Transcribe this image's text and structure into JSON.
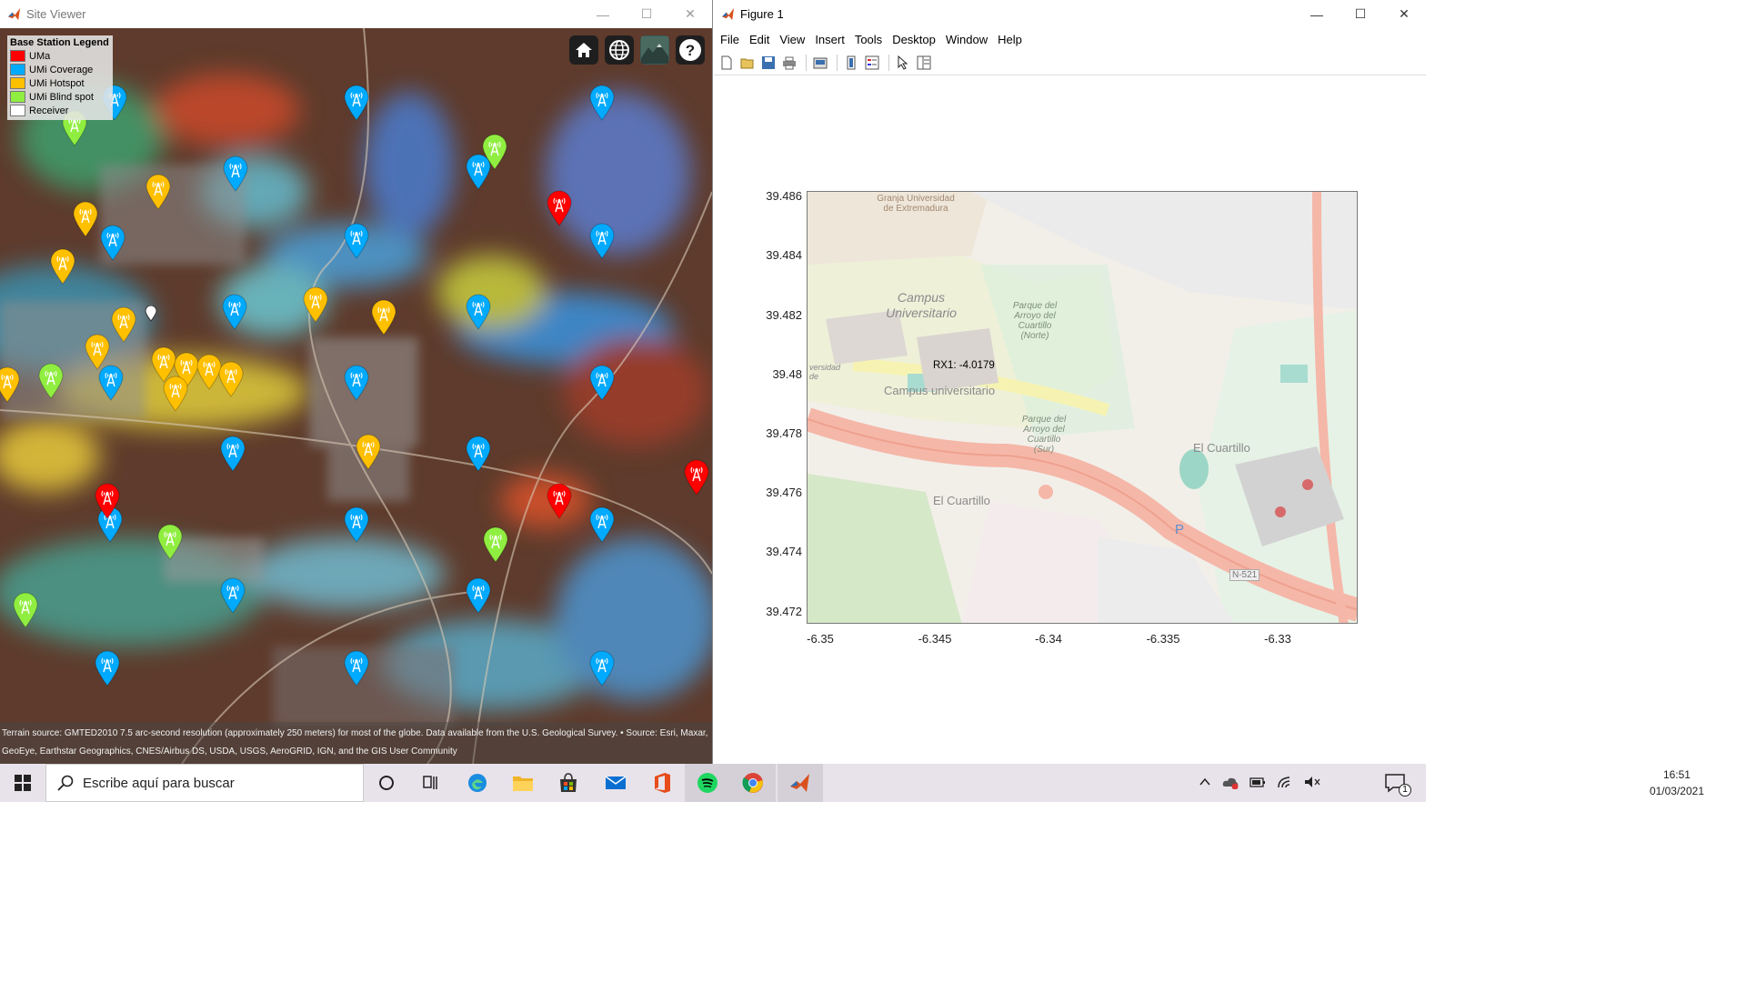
{
  "site_viewer": {
    "title": "Site Viewer",
    "controls": {
      "minimize": "—",
      "maximize": "☐",
      "close": "✕"
    },
    "legend": {
      "title": "Base Station Legend",
      "items": [
        {
          "label": "UMa",
          "color": "#ff0000"
        },
        {
          "label": "UMi Coverage",
          "color": "#00aaff"
        },
        {
          "label": "UMi Hotspot",
          "color": "#ffc000"
        },
        {
          "label": "UMi Blind spot",
          "color": "#90ee40"
        },
        {
          "label": "Receiver",
          "color": "#ffffff"
        }
      ]
    },
    "buttons": [
      "home-icon",
      "globe-icon",
      "terrain-icon",
      "help-icon"
    ],
    "attribution": "Terrain source: GMTED2010 7.5 arc-second resolution (approximately 250 meters) for most of the globe. Data available from the U.S. Geological Survey. • Source: Esri, Maxar, GeoEye, Earthstar Geographics, CNES/Airbus DS, USDA, USGS, AeroGRID, IGN, and the GIS User Community"
  },
  "figure": {
    "title": "Figure 1",
    "controls": {
      "minimize": "—",
      "maximize": "☐",
      "close": "✕"
    },
    "menu": [
      "File",
      "Edit",
      "View",
      "Insert",
      "Tools",
      "Desktop",
      "Window",
      "Help"
    ],
    "toolbar": [
      "new-icon",
      "open-icon",
      "save-icon",
      "print-icon",
      "print-preview-icon",
      "colorbar-icon",
      "legend-icon",
      "pointer-icon",
      "property-editor-icon"
    ],
    "yticks": [
      "39.486",
      "39.484",
      "39.482",
      "39.48",
      "39.478",
      "39.476",
      "39.474",
      "39.472"
    ],
    "xticks": [
      "-6.35",
      "-6.345",
      "-6.34",
      "-6.335",
      "-6.33"
    ],
    "datatip": "RX1: -4.0179",
    "map_labels": {
      "campus_upper": "Campus Universitario",
      "campus_lower": "Campus universitario",
      "granja": "Granja Universidad de Extremadura",
      "parque_norte": "Parque del Arroyo del Cuartillo (Norte)",
      "parque_sur": "Parque del Arroyo del Cuartillo (Sur)",
      "cuartillo_left": "El Cuartillo",
      "cuartillo_right": "El Cuartillo",
      "universidad_frag": "versidad de",
      "road": "N-521",
      "parking": "P"
    }
  },
  "taskbar": {
    "search_placeholder": "Escribe aquí para buscar",
    "icons": [
      "windows-start-icon",
      "cortana-icon",
      "task-view-icon",
      "edge-icon",
      "file-explorer-icon",
      "store-icon",
      "mail-icon",
      "office-icon",
      "spotify-icon",
      "chrome-icon",
      "matlab-icon"
    ],
    "time": "16:51",
    "date": "01/03/2021",
    "notification_count": "1"
  }
}
